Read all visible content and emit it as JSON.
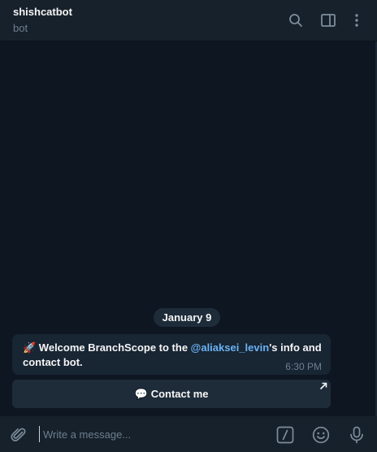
{
  "header": {
    "title": "shishcatbot",
    "subtitle": "bot",
    "icons": [
      "search-icon",
      "sidebar-toggle-icon",
      "more-vertical-icon"
    ]
  },
  "chat": {
    "date": "January 9",
    "message": {
      "emoji": "🚀",
      "text_before": " Welcome BranchScope to the ",
      "mention": "@aliaksei_levin",
      "text_after": "'s info and contact bot.",
      "time": "6:30 PM"
    },
    "inline_button": {
      "emoji": "💬",
      "label": "Contact me"
    }
  },
  "composer": {
    "placeholder": "Write a message...",
    "icons": [
      "attach-icon",
      "bot-commands-icon",
      "emoji-icon",
      "microphone-icon"
    ]
  },
  "colors": {
    "background": "#0e1621",
    "header": "#17212b",
    "bubble": "#182533",
    "accent": "#6ab3f3",
    "muted": "#6d7f8f"
  }
}
